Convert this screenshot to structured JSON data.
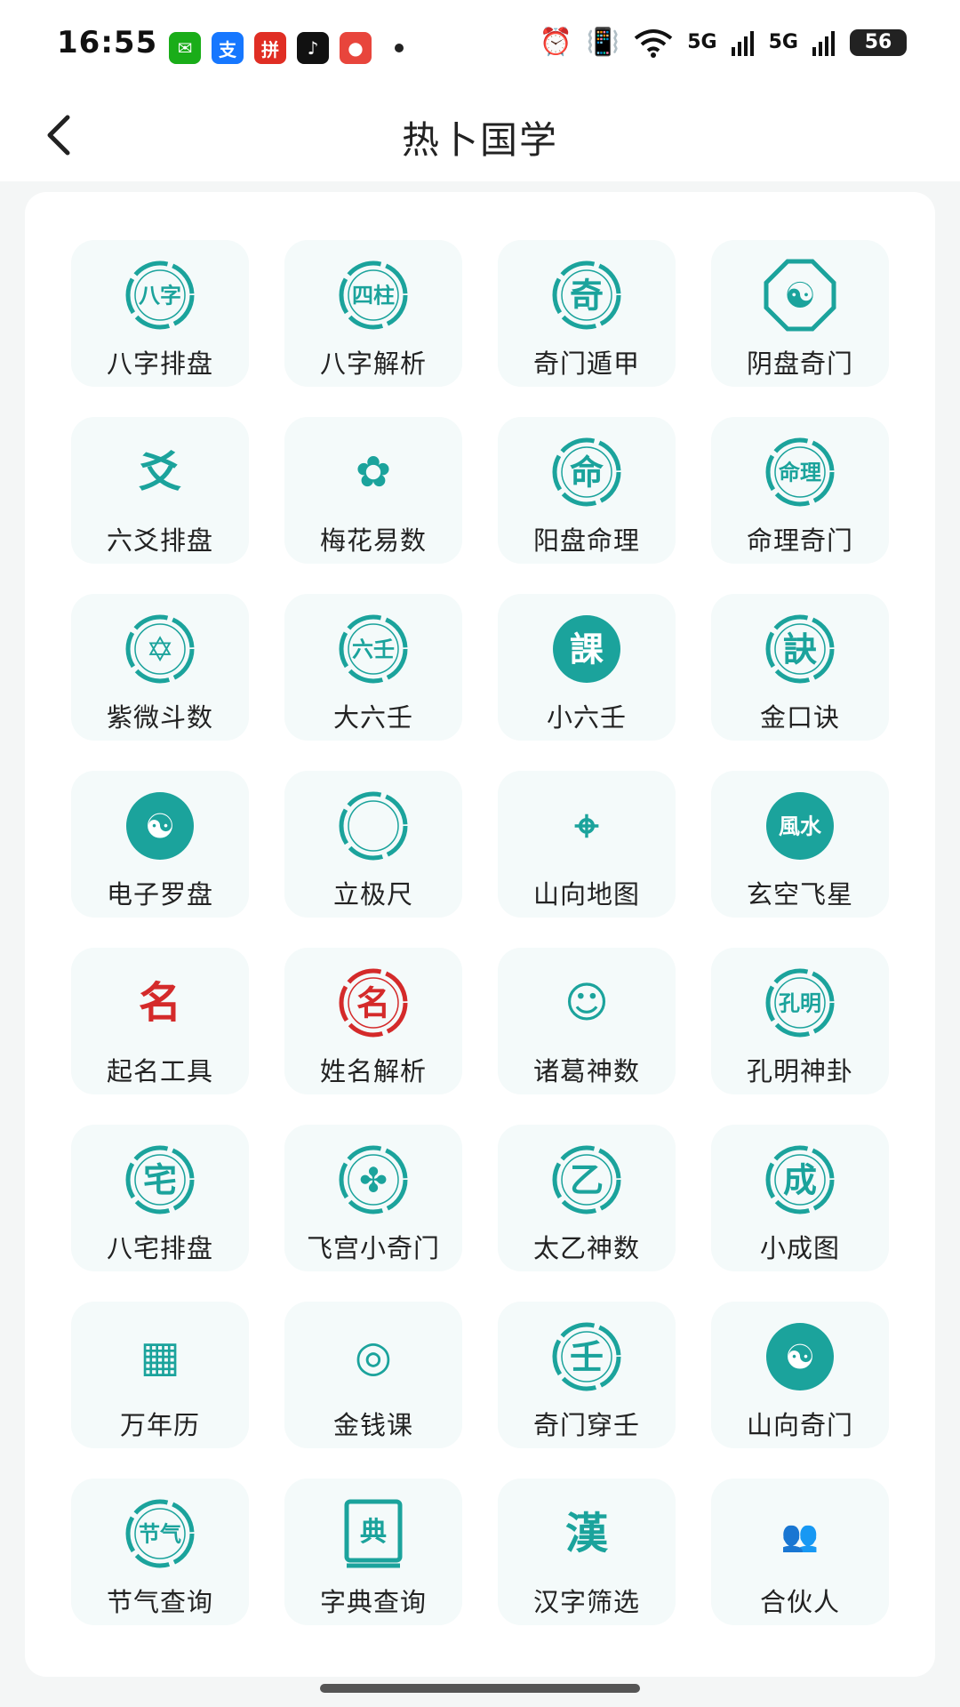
{
  "status_bar": {
    "time": "16:55",
    "apps": [
      {
        "icon": "wechat-icon",
        "glyph": "✉",
        "color": "#1aad19"
      },
      {
        "icon": "alipay-icon",
        "glyph": "支",
        "color": "#1677ff"
      },
      {
        "icon": "shop-icon",
        "glyph": "拼",
        "color": "#e02e24"
      },
      {
        "icon": "tiktok-icon",
        "glyph": "♪",
        "color": "#111111"
      },
      {
        "icon": "map-pin-icon",
        "glyph": "●",
        "color": "#e8453c"
      }
    ],
    "signal_1": "5G",
    "signal_2": "5G",
    "battery": "56"
  },
  "nav": {
    "title": "热卜国学"
  },
  "accent_color": "#1ba39c",
  "tools": [
    {
      "label": "八字排盘",
      "icon": "bazi-seal-icon",
      "glyph": "八字",
      "style": "ring",
      "color": "#1ba39c"
    },
    {
      "label": "八字解析",
      "icon": "sizhu-seal-icon",
      "glyph": "四柱",
      "style": "ring",
      "color": "#1ba39c"
    },
    {
      "label": "奇门遁甲",
      "icon": "qi-seal-icon",
      "glyph": "奇",
      "style": "ring",
      "color": "#1ba39c"
    },
    {
      "label": "阴盘奇门",
      "icon": "yinyang-bagua-icon",
      "glyph": "☯",
      "style": "octagon",
      "color": "#1ba39c"
    },
    {
      "label": "六爻排盘",
      "icon": "yao-cross-icon",
      "glyph": "爻",
      "style": "plain",
      "color": "#1ba39c"
    },
    {
      "label": "梅花易数",
      "icon": "plum-blossom-icon",
      "glyph": "✿",
      "style": "plain",
      "color": "#1ba39c"
    },
    {
      "label": "阳盘命理",
      "icon": "ming-seal-icon",
      "glyph": "命",
      "style": "ring",
      "color": "#1ba39c"
    },
    {
      "label": "命理奇门",
      "icon": "ming-li-seal-icon",
      "glyph": "命理",
      "style": "ring",
      "color": "#1ba39c"
    },
    {
      "label": "紫微斗数",
      "icon": "hexagram-star-icon",
      "glyph": "✡",
      "style": "ring",
      "color": "#1ba39c"
    },
    {
      "label": "大六壬",
      "icon": "liuren-seal-icon",
      "glyph": "六壬",
      "style": "ring",
      "color": "#1ba39c"
    },
    {
      "label": "小六壬",
      "icon": "ke-seal-icon",
      "glyph": "課",
      "style": "filled",
      "color": "#1ba39c"
    },
    {
      "label": "金口诀",
      "icon": "jue-seal-icon",
      "glyph": "訣",
      "style": "ring",
      "color": "#1ba39c"
    },
    {
      "label": "电子罗盘",
      "icon": "compass-icon",
      "glyph": "☯",
      "style": "filled",
      "color": "#1ba39c"
    },
    {
      "label": "立极尺",
      "icon": "ring-ruler-icon",
      "glyph": "",
      "style": "ring",
      "color": "#1ba39c"
    },
    {
      "label": "山向地图",
      "icon": "map-location-icon",
      "glyph": "⌖",
      "style": "plain",
      "color": "#1ba39c"
    },
    {
      "label": "玄空飞星",
      "icon": "fengshui-seal-icon",
      "glyph": "風水",
      "style": "filled",
      "color": "#1ba39c"
    },
    {
      "label": "起名工具",
      "icon": "name-tool-icon",
      "glyph": "名",
      "style": "plain",
      "color": "#d42a2a"
    },
    {
      "label": "姓名解析",
      "icon": "name-cycle-icon",
      "glyph": "名",
      "style": "ring",
      "color": "#d42a2a"
    },
    {
      "label": "诸葛神数",
      "icon": "zhuge-portrait-icon",
      "glyph": "☺",
      "style": "plain",
      "color": "#1ba39c"
    },
    {
      "label": "孔明神卦",
      "icon": "kongming-seal-icon",
      "glyph": "孔明",
      "style": "ring",
      "color": "#1ba39c"
    },
    {
      "label": "八宅排盘",
      "icon": "zhai-seal-icon",
      "glyph": "宅",
      "style": "ring",
      "color": "#1ba39c"
    },
    {
      "label": "飞宫小奇门",
      "icon": "feigong-seal-icon",
      "glyph": "✤",
      "style": "ring",
      "color": "#1ba39c"
    },
    {
      "label": "太乙神数",
      "icon": "taiyi-seal-icon",
      "glyph": "乙",
      "style": "ring",
      "color": "#1ba39c"
    },
    {
      "label": "小成图",
      "icon": "cheng-seal-icon",
      "glyph": "成",
      "style": "ring",
      "color": "#1ba39c"
    },
    {
      "label": "万年历",
      "icon": "calendar-icon",
      "glyph": "▦",
      "style": "plain",
      "color": "#1ba39c"
    },
    {
      "label": "金钱课",
      "icon": "coins-icon",
      "glyph": "◎",
      "style": "plain",
      "color": "#1ba39c"
    },
    {
      "label": "奇门穿壬",
      "icon": "ren-seal-icon",
      "glyph": "壬",
      "style": "ring",
      "color": "#1ba39c"
    },
    {
      "label": "山向奇门",
      "icon": "shanxiang-yinyang-icon",
      "glyph": "☯",
      "style": "filled",
      "color": "#1ba39c"
    },
    {
      "label": "节气查询",
      "icon": "jieqi-seal-icon",
      "glyph": "节气",
      "style": "ring",
      "color": "#1ba39c"
    },
    {
      "label": "字典查询",
      "icon": "dictionary-icon",
      "glyph": "典",
      "style": "book",
      "color": "#1ba39c"
    },
    {
      "label": "汉字筛选",
      "icon": "han-character-icon",
      "glyph": "漢",
      "style": "plain",
      "color": "#1ba39c"
    },
    {
      "label": "合伙人",
      "icon": "partners-icon",
      "glyph": "👥",
      "style": "plain",
      "color": "#d42a2a"
    }
  ]
}
